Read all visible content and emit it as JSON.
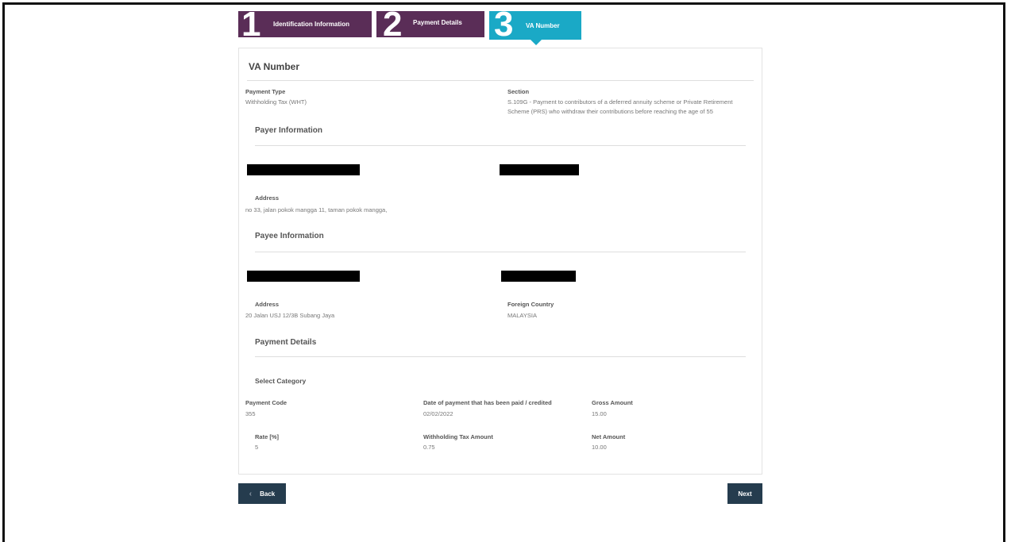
{
  "steps": [
    {
      "number": "1",
      "label": "Identification Information"
    },
    {
      "number": "2",
      "label": "Payment Details"
    },
    {
      "number": "3",
      "label": "VA Number"
    }
  ],
  "card": {
    "title": "VA Number",
    "payment_type": {
      "label": "Payment Type",
      "value": "Withholding Tax (WHT)"
    },
    "section": {
      "label": "Section",
      "value": "S.109G - Payment to contributors of a deferred annuity scheme or Private Retirement Scheme (PRS) who withdraw their contributions before reaching the age of 55"
    },
    "payer": {
      "heading": "Payer Information",
      "address_label": "Address",
      "address": "no 33, jalan pokok mangga 11, taman pokok mangga,"
    },
    "payee": {
      "heading": "Payee Information",
      "address_label": "Address",
      "address": "20 Jalan USJ 12/3B Subang Jaya",
      "country_label": "Foreign Country",
      "country": "MALAYSIA"
    },
    "payment_details": {
      "heading": "Payment Details",
      "select_category": "Select Category",
      "payment_code_label": "Payment Code",
      "payment_code": "355",
      "date_label": "Date of payment that has been paid / credited",
      "date": "02/02/2022",
      "gross_label": "Gross Amount",
      "gross": "15.00",
      "rate_label": "Rate [%]",
      "rate": "5",
      "wht_label": "Withholding Tax Amount",
      "wht": "0.75",
      "net_label": "Net Amount",
      "net": "10.00"
    }
  },
  "buttons": {
    "back": "Back",
    "next": "Next"
  },
  "colors": {
    "step_active": "#1aa9c6",
    "step_inactive": "#5a2d57",
    "button": "#253c4e"
  }
}
